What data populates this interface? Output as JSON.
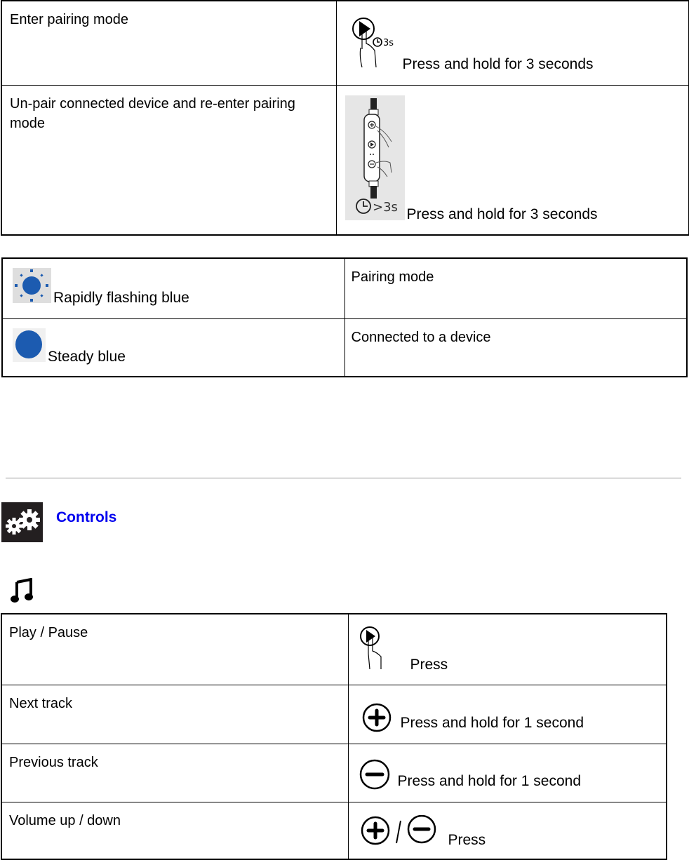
{
  "pairing_table": {
    "rows": [
      {
        "action": "Enter pairing mode",
        "instruction": "Press and hold for 3 seconds",
        "icon": "play-button-hold-3s-icon",
        "icon_label": "3s"
      },
      {
        "action": "Un-pair connected device and re-enter pairing mode",
        "instruction": "Press and hold for 3 seconds",
        "icon": "remote-plus-minus-hold-icon",
        "icon_label": ">3s"
      }
    ]
  },
  "led_table": {
    "rows": [
      {
        "light": "Rapidly flashing blue",
        "meaning": "Pairing mode",
        "icon": "flashing-blue-light-icon",
        "color": "#1c5bb0"
      },
      {
        "light": "Steady blue",
        "meaning": "Connected to a device",
        "icon": "steady-blue-light-icon",
        "color": "#1c5bb0"
      }
    ]
  },
  "controls_section": {
    "title": "Controls",
    "title_color": "#0000ee",
    "icon": "gears-icon",
    "sub_icon": "music-note-icon"
  },
  "controls_table": {
    "rows": [
      {
        "action": "Play / Pause",
        "instruction": "Press",
        "icon": "play-button-press-icon"
      },
      {
        "action": "Next track",
        "instruction": "Press and hold for 1 second",
        "icon": "plus-button-icon"
      },
      {
        "action": "Previous track",
        "instruction": "Press and hold for 1 second",
        "icon": "minus-button-icon"
      },
      {
        "action": "Volume up / down",
        "instruction": "Press",
        "icon": "plus-minus-buttons-icon",
        "separator": "/"
      }
    ]
  }
}
